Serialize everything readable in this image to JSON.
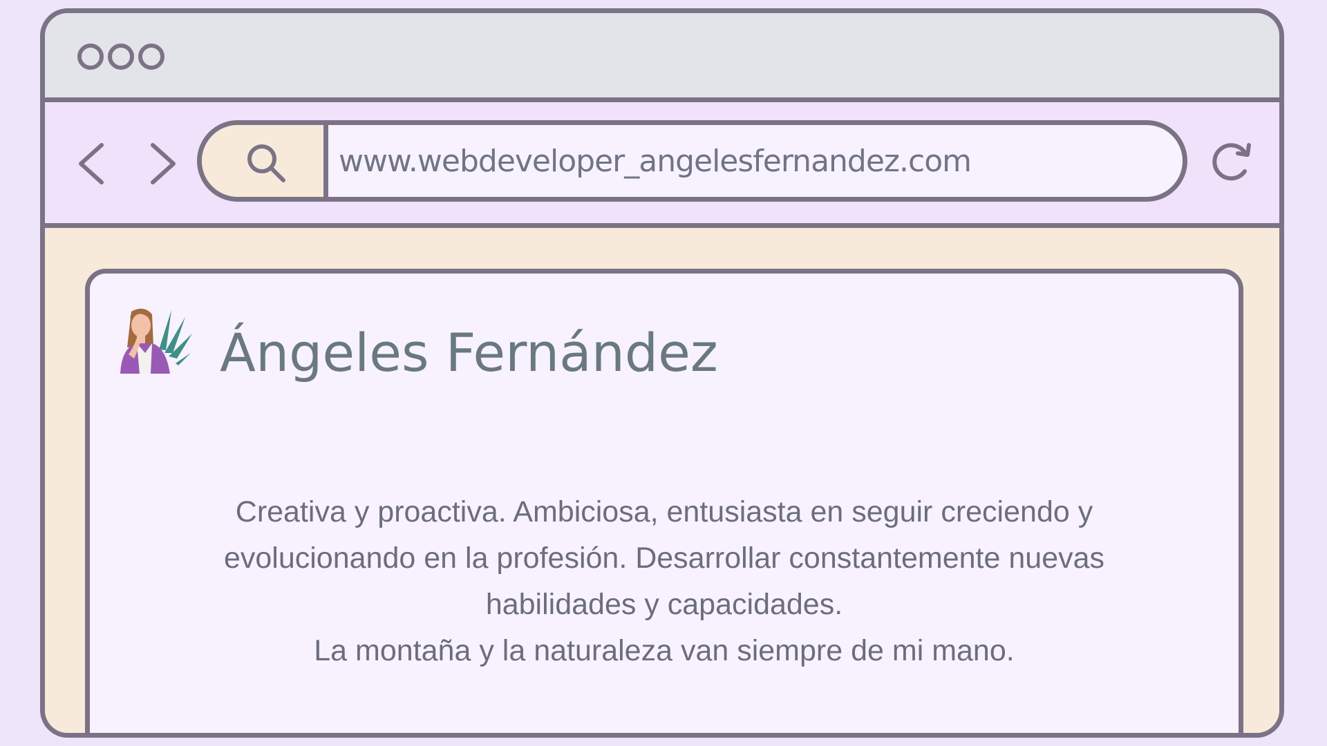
{
  "browser": {
    "url": "www.webdeveloper_angelesfernandez.com",
    "icons": [
      "back-arrow-icon",
      "forward-arrow-icon",
      "search-icon",
      "reload-icon"
    ]
  },
  "profile": {
    "name": "Ángeles Fernández",
    "bio_lines": [
      "Creativa y proactiva. Ambiciosa, entusiasta en seguir creciendo y",
      "evolucionando en la profesión. Desarrollar constantemente nuevas",
      "habilidades y capacidades.",
      "La montaña y la naturaleza van siempre de mi mano."
    ]
  },
  "colors": {
    "background": "#efe5fa",
    "frame": "#7b7385",
    "titlebar": "#e2e4e9",
    "navbar": "#f0e2fb",
    "content_bg": "#f7eadb",
    "card": "#f7f2fe",
    "name_text": "#6a7880",
    "avatar_purple": "#9b59b6"
  }
}
